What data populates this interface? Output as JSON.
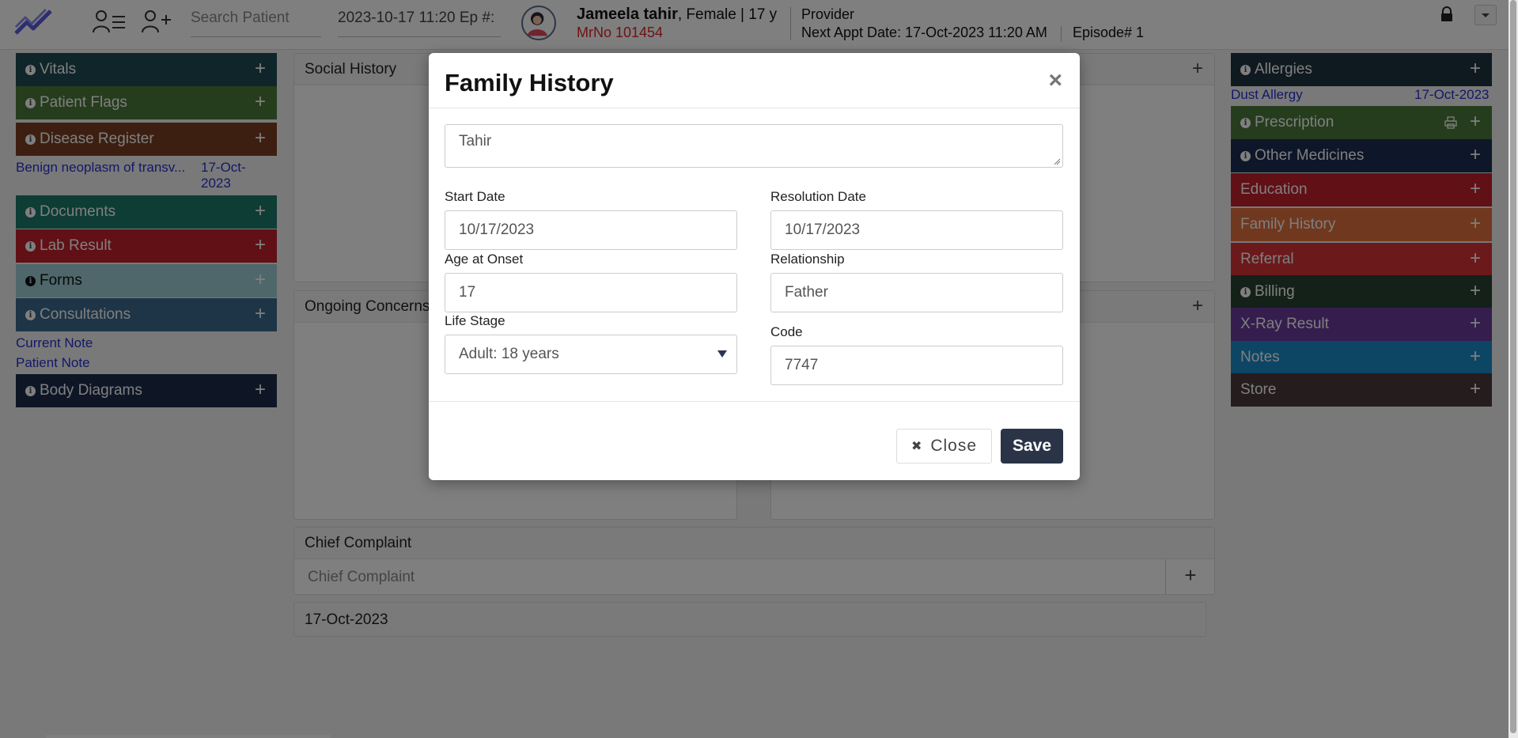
{
  "topbar": {
    "search_placeholder": "Search Patient",
    "episode_label": "2023-10-17 11:20 Ep #:",
    "patient_name": "Jameela tahir",
    "patient_info": ", Female | 17 y",
    "mrno": "MrNo 101454",
    "provider": "Provider",
    "next_appt_label": "Next Appt Date",
    "next_appt_value": ": 17-Oct-2023 11:20 AM",
    "episode": "Episode# 1"
  },
  "left_panel": {
    "items": [
      {
        "label": "Vitals",
        "color": "#1f4a52"
      },
      {
        "label": "Patient Flags",
        "color": "#4a7a3a"
      },
      {
        "label": "Disease Register",
        "color": "#7a3f24"
      },
      {
        "label": "Documents",
        "color": "#1b7a6a"
      },
      {
        "label": "Lab Result",
        "color": "#c2202d"
      },
      {
        "label": "Forms",
        "color": "#9fcfd4"
      },
      {
        "label": "Consultations",
        "color": "#3a6a8c"
      },
      {
        "label": "Body Diagrams",
        "color": "#1c2c4c"
      }
    ],
    "disease_link": "Benign neoplasm of transv...",
    "disease_date_1": "17-Oct-",
    "disease_date_2": "2023",
    "current_note": "Current Note",
    "patient_note": "Patient Note"
  },
  "center": {
    "social_history": "Social History",
    "ongoing_concerns": "Ongoing Concerns",
    "chief_complaint_title": "Chief Complaint",
    "chief_complaint_placeholder": "Chief Complaint",
    "date": "17-Oct-2023"
  },
  "right_panel": {
    "items": [
      {
        "label": "Allergies",
        "color": "#1f3440",
        "info": true
      },
      {
        "label": "Prescription",
        "color": "#4a7a3a",
        "info": true
      },
      {
        "label": "Other Medicines",
        "color": "#1c2c52",
        "info": true
      },
      {
        "label": "Education",
        "color": "#c2202d",
        "info": false
      },
      {
        "label": "Family History",
        "color": "#e0703c",
        "info": false
      },
      {
        "label": "Referral",
        "color": "#d63236",
        "info": false
      },
      {
        "label": "Billing",
        "color": "#274233",
        "info": true
      },
      {
        "label": "X-Ray Result",
        "color": "#6a3a9c",
        "info": false
      },
      {
        "label": "Notes",
        "color": "#1a8acb",
        "info": false
      },
      {
        "label": "Store",
        "color": "#4a3a3a",
        "info": false
      }
    ],
    "allergy_name": "Dust Allergy",
    "allergy_date": "17-Oct-2023"
  },
  "modal": {
    "title": "Family History",
    "close_icon": "×",
    "description_value": "Tahir",
    "start_date_label": "Start Date",
    "start_date_value": "10/17/2023",
    "resolution_date_label": "Resolution Date",
    "resolution_date_value": "10/17/2023",
    "age_onset_label": "Age at Onset",
    "age_onset_value": "17",
    "relationship_label": "Relationship",
    "relationship_value": "Father",
    "life_stage_label": "Life Stage",
    "life_stage_value": "Adult: 18 years",
    "code_label": "Code",
    "code_value": "7747",
    "close_button": "Close",
    "close_button_icon": "✖",
    "save_button": "Save"
  }
}
